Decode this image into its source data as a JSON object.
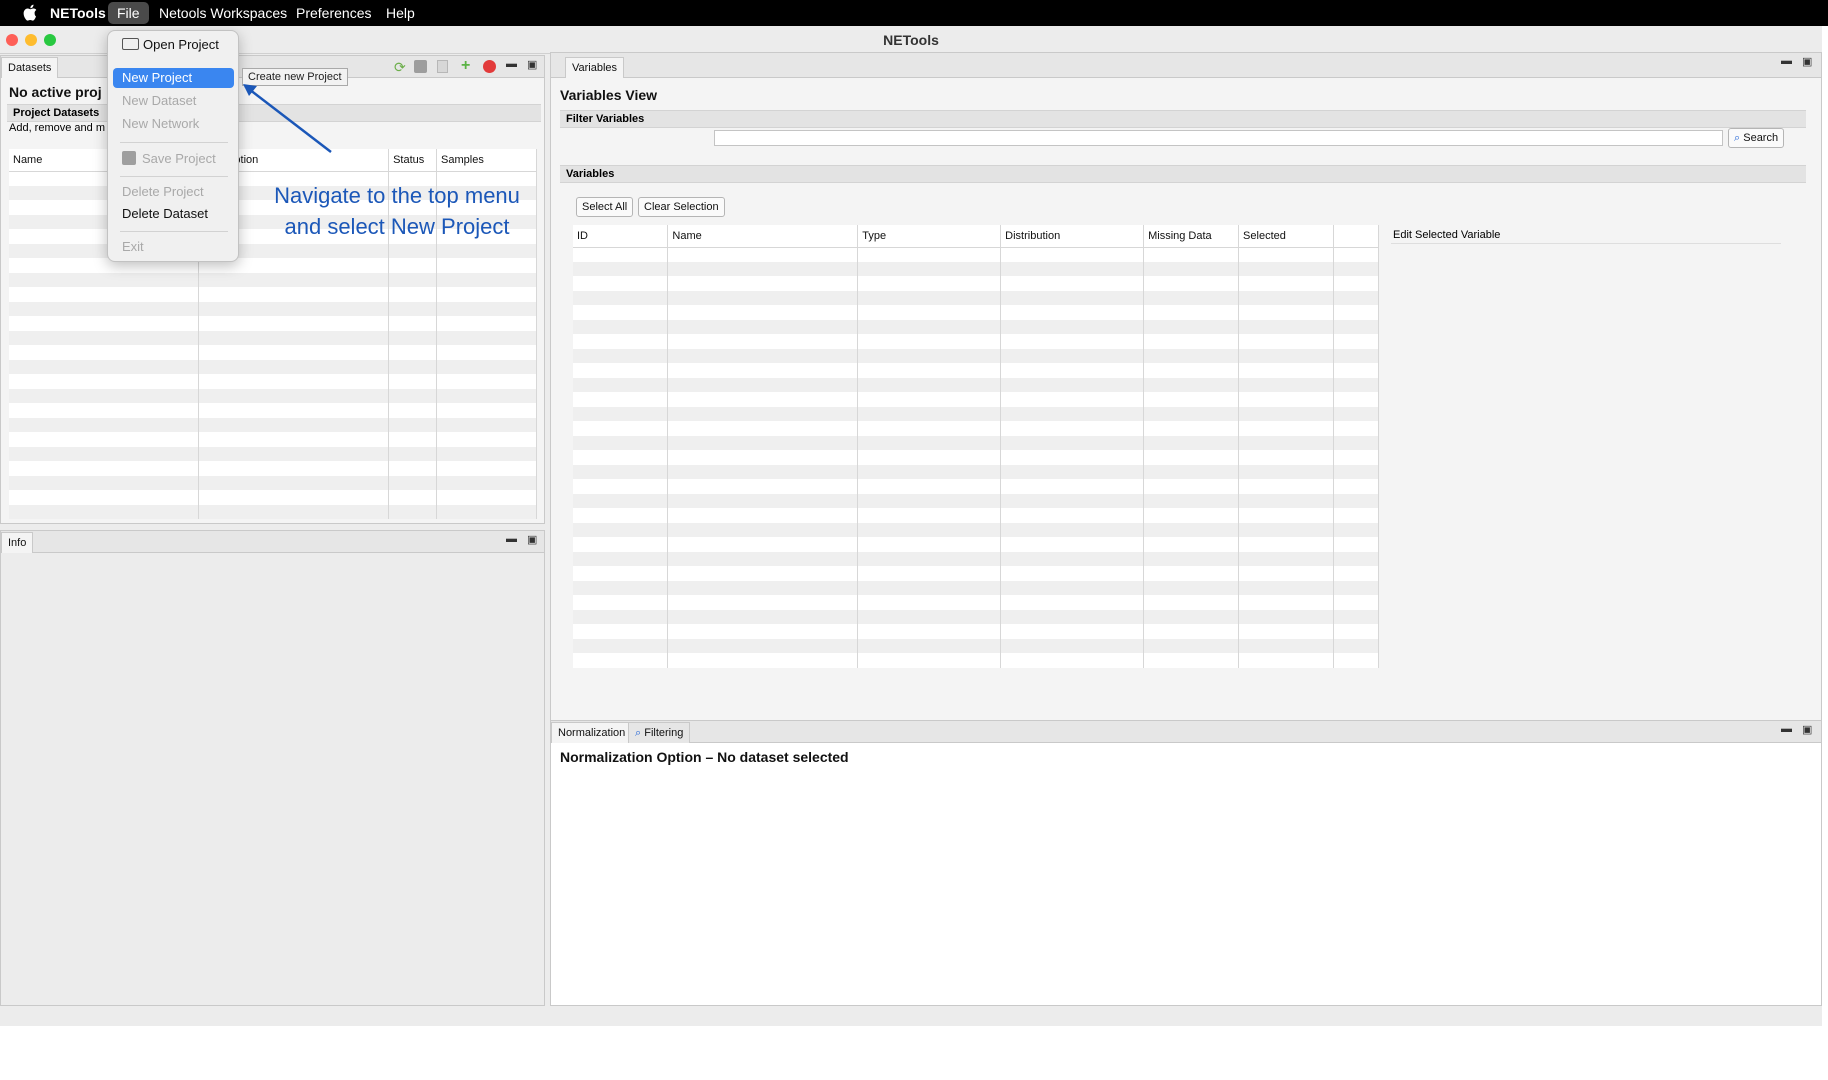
{
  "menubar": {
    "apple": "",
    "app_name": "NETools",
    "items": [
      "File",
      "Netools Workspaces",
      "Preferences",
      "Help"
    ]
  },
  "window": {
    "title": "NETools"
  },
  "datasets_panel": {
    "tab": "Datasets",
    "heading": "No active proj",
    "section_title": "Project Datasets",
    "section_desc": "Add, remove and m",
    "columns": [
      "Name",
      "Description",
      "Status",
      "Samples"
    ]
  },
  "info_panel": {
    "tab": "Info"
  },
  "variables_panel": {
    "tab": "Variables",
    "heading": "Variables View",
    "filter_title": "Filter Variables",
    "search_value": "",
    "search_button": "Search",
    "variables_title": "Variables",
    "select_all": "Select All",
    "clear_selection": "Clear Selection",
    "columns": [
      "ID",
      "Name",
      "Type",
      "Distribution",
      "Missing Data",
      "Selected",
      ""
    ],
    "edit_title": "Edit Selected Variable"
  },
  "bottom_panel": {
    "tabs": [
      "Normalization",
      "Filtering"
    ],
    "message": "Normalization Option – No dataset selected"
  },
  "file_menu": {
    "items": [
      {
        "label": "Open Project",
        "state": "enabled",
        "icon": "folder-icon"
      },
      {
        "label": "New Project",
        "state": "selected"
      },
      {
        "label": "New Dataset",
        "state": "disabled"
      },
      {
        "label": "New Network",
        "state": "disabled"
      },
      {
        "label": "Save Project",
        "state": "disabled",
        "icon": "save-icon"
      },
      {
        "label": "Delete Project",
        "state": "disabled"
      },
      {
        "label": "Delete Dataset",
        "state": "enabled"
      },
      {
        "label": "Exit",
        "state": "disabled"
      }
    ]
  },
  "tooltip": "Create new Project",
  "annotation": {
    "line1": "Navigate to the top menu",
    "line2": "and select New Project",
    "color": "#1b57b8"
  },
  "colors": {
    "selection": "#3a86f0",
    "close": "#fe5f57",
    "minimize": "#febc2e",
    "zoom": "#28c840"
  }
}
